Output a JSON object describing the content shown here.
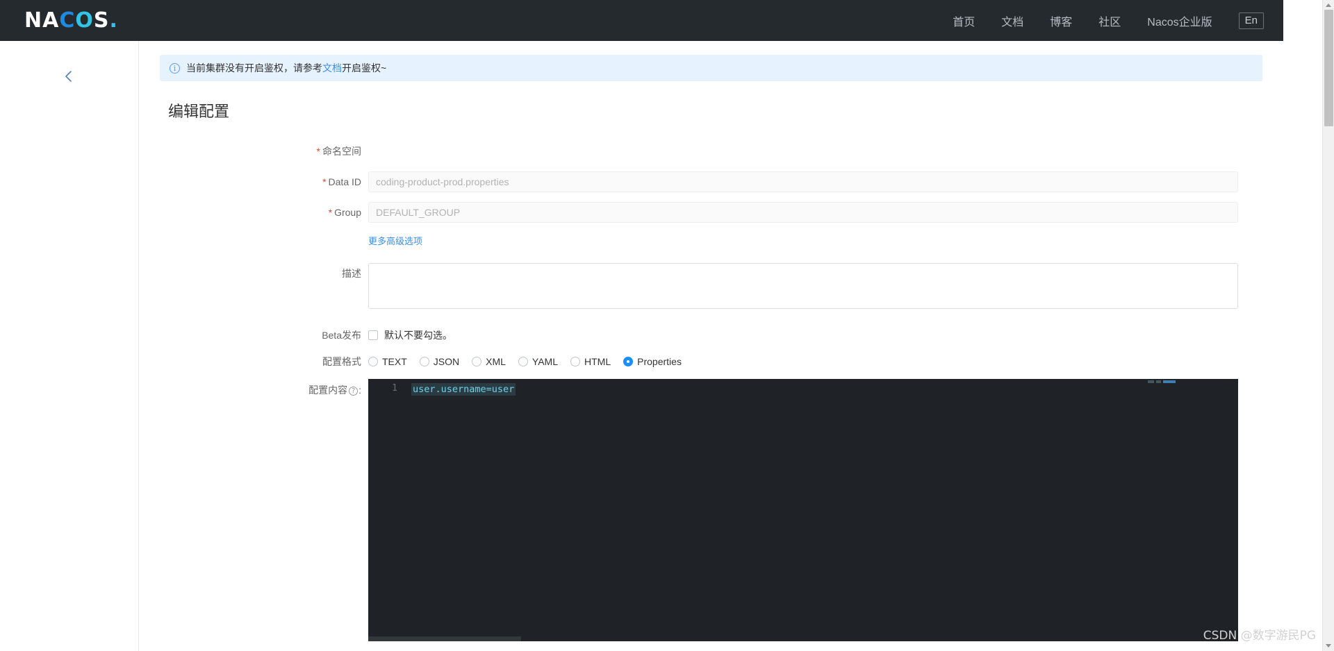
{
  "header": {
    "logo": {
      "part1": "NA",
      "part2": "C",
      "part3": "O",
      "part4": "S",
      "dot": "."
    },
    "nav": [
      {
        "label": "首页"
      },
      {
        "label": "文档"
      },
      {
        "label": "博客"
      },
      {
        "label": "社区"
      },
      {
        "label": "Nacos企业版"
      }
    ],
    "lang_button": "En"
  },
  "sidebar": {
    "collapse_icon": "chevron-left-icon"
  },
  "banner": {
    "icon": "info-icon",
    "text_before": "当前集群没有开启鉴权，请参考",
    "link": "文档",
    "text_after": "开启鉴权~"
  },
  "page": {
    "title": "编辑配置"
  },
  "form": {
    "namespace": {
      "label": "命名空间",
      "required": true,
      "value": ""
    },
    "data_id": {
      "label": "Data ID",
      "required": true,
      "value": "coding-product-prod.properties",
      "disabled": true
    },
    "group": {
      "label": "Group",
      "required": true,
      "value": "DEFAULT_GROUP",
      "disabled": true
    },
    "advanced_link": "更多高级选项",
    "description": {
      "label": "描述",
      "value": "",
      "placeholder": ""
    },
    "beta": {
      "label": "Beta发布",
      "checkbox_text": "默认不要勾选。",
      "checked": false
    },
    "config_format": {
      "label": "配置格式",
      "options": [
        {
          "label": "TEXT",
          "selected": false
        },
        {
          "label": "JSON",
          "selected": false
        },
        {
          "label": "XML",
          "selected": false
        },
        {
          "label": "YAML",
          "selected": false
        },
        {
          "label": "HTML",
          "selected": false
        },
        {
          "label": "Properties",
          "selected": true
        }
      ]
    },
    "config_content": {
      "label_prefix": "配置内容",
      "label_suffix": ":",
      "help_icon": "question-mark-icon",
      "lines": [
        {
          "number": "1",
          "text": "user.username=user"
        }
      ]
    }
  },
  "watermark": "CSDN @数字游民PG",
  "colors": {
    "header_bg": "#252a2f",
    "accent_blue": "#1890ff",
    "link_blue": "#3a8ee6",
    "banner_bg": "#e6f2fd",
    "required_red": "#cf4c35",
    "editor_bg": "#1f2226",
    "code_cyan": "#6fd3e8"
  }
}
